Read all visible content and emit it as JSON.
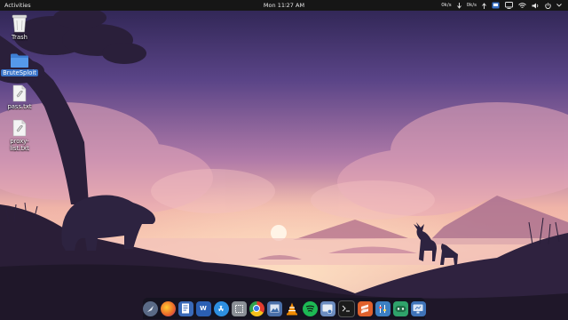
{
  "topbar": {
    "activities": "Activities",
    "clock": "Mon 11∶27 AM",
    "tray": {
      "net_down": "0k/s",
      "net_up": "0k/s"
    }
  },
  "desktop": {
    "icons": [
      {
        "label": "Trash",
        "icon": "trash-icon"
      },
      {
        "label": "BruteSploit",
        "icon": "folder-icon",
        "selected": true
      },
      {
        "label": "pass.txt",
        "icon": "text-file-icon"
      },
      {
        "label": "proxy-list.txt",
        "icon": "text-file-icon"
      }
    ]
  },
  "dock": {
    "apps": [
      {
        "name": "launcher-icon",
        "color": "#5a6a86"
      },
      {
        "name": "firefox-icon",
        "color": "#e8642a"
      },
      {
        "name": "writer-doc-icon",
        "color": "#3a6ab8"
      },
      {
        "name": "word-icon",
        "color": "#2b5fb3"
      },
      {
        "name": "app-store-icon",
        "color": "#2d8fe0"
      },
      {
        "name": "screenshot-icon",
        "color": "#8a8f96"
      },
      {
        "name": "chrome-icon",
        "color": "#e33b2e"
      },
      {
        "name": "image-viewer-icon",
        "color": "#4a6fa8"
      },
      {
        "name": "vlc-icon",
        "color": "#f08a00"
      },
      {
        "name": "spotify-icon",
        "color": "#1db954"
      },
      {
        "name": "system-settings-icon",
        "color": "#6c8cc0"
      },
      {
        "name": "terminal-icon",
        "color": "#1b1b1b"
      },
      {
        "name": "sublime-icon",
        "color": "#e0612c"
      },
      {
        "name": "tweaks-icon",
        "color": "#3c7fc2"
      },
      {
        "name": "game-console-icon",
        "color": "#2fa36b"
      },
      {
        "name": "monitor-icon",
        "color": "#3f73b8"
      }
    ]
  }
}
